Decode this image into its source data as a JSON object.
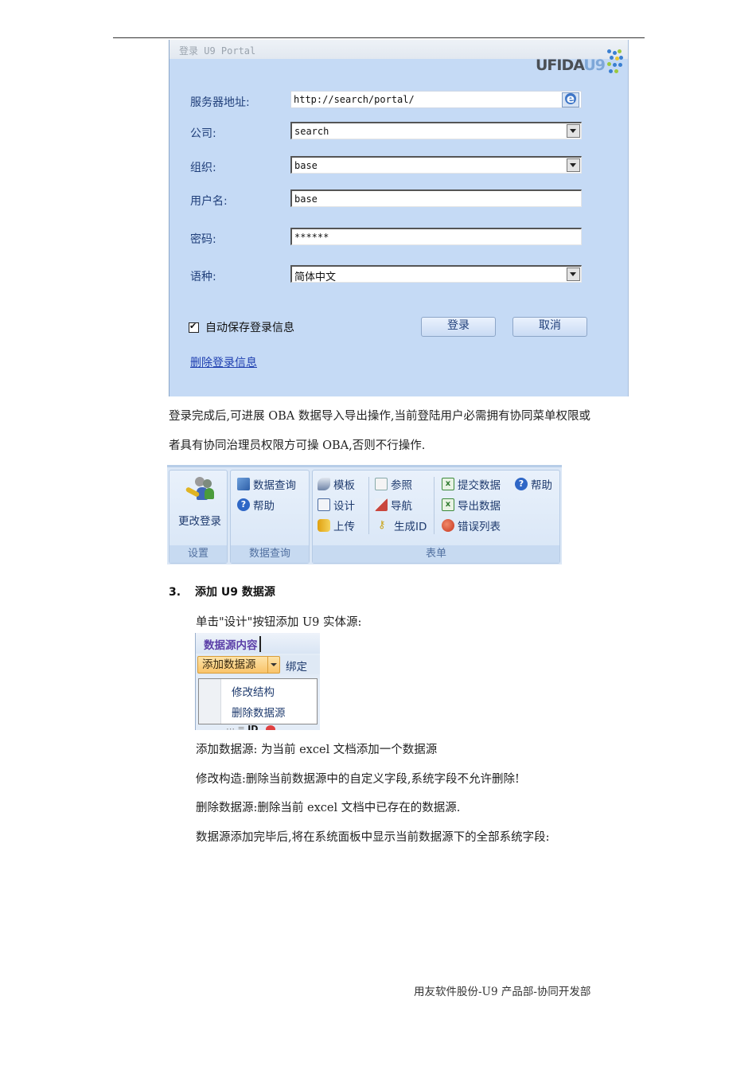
{
  "login_dialog": {
    "title": "登录 U9 Portal",
    "logo": {
      "text_main": "UFIDA",
      "text_accent": "U9"
    },
    "fields": [
      {
        "label": "服务器地址:",
        "value": "http://search/portal/",
        "type": "text",
        "icon": "ie-browse-icon"
      },
      {
        "label": "公司:",
        "value": "search",
        "type": "select"
      },
      {
        "label": "组织:",
        "value": "base",
        "type": "select"
      },
      {
        "label": "用户名:",
        "value": "base",
        "type": "text"
      },
      {
        "label": "密码:",
        "value": "******",
        "type": "password"
      },
      {
        "label": "语种:",
        "value": "简体中文",
        "type": "select"
      }
    ],
    "auto_save": {
      "label": "自动保存登录信息",
      "checked": true
    },
    "login_button": "登录",
    "cancel_button": "取消",
    "delete_link": "删除登录信息"
  },
  "paragraph1": {
    "line1": "登录完成后,可进展 OBA 数据导入导出操作,当前登陆用户必需拥有协同菜单权限或",
    "line2": "者具有协同治理员权限方可操  OBA,否则不行操作."
  },
  "ribbon": {
    "groups": [
      {
        "label": "设置",
        "items": [
          {
            "label": "更改登录",
            "icon": "change-login-icon"
          }
        ]
      },
      {
        "label": "数据查询",
        "items": [
          {
            "label": "数据查询",
            "icon": "data-query-icon"
          },
          {
            "label": "帮助",
            "icon": "help-icon"
          }
        ]
      },
      {
        "label": "表单",
        "columns": [
          [
            {
              "label": "模板",
              "icon": "template-icon"
            },
            {
              "label": "设计",
              "icon": "design-icon"
            },
            {
              "label": "上传",
              "icon": "upload-icon"
            }
          ],
          [
            {
              "label": "参照",
              "icon": "reference-icon"
            },
            {
              "label": "导航",
              "icon": "navigation-icon"
            },
            {
              "label": "生成ID",
              "icon": "key-icon"
            }
          ],
          [
            {
              "label": "提交数据",
              "icon": "excel-submit-icon"
            },
            {
              "label": "导出数据",
              "icon": "excel-export-icon"
            },
            {
              "label": "错误列表",
              "icon": "error-list-icon"
            }
          ],
          [
            {
              "label": "帮助",
              "icon": "help-icon"
            }
          ]
        ]
      }
    ]
  },
  "section3": {
    "number": "3.",
    "title": "添加  U9 数据源",
    "intro": "单击\"设计\"按钮添加  U9  实体源:"
  },
  "datasource_panel": {
    "header": "数据源内容",
    "add_button": "添加数据源",
    "bind_button": "绑定",
    "menu_items": [
      "修改结构",
      "删除数据源"
    ],
    "tree_fragment": "ID"
  },
  "descriptions": [
    "添加数据源:  为当前  excel 文档添加一个数据源",
    "修改构造:删除当前数据源中的自定义字段,系统字段不允许删除!",
    "删除数据源:删除当前  excel 文档中已存在的数据源.",
    "数据源添加完毕后,将在系统面板中显示当前数据源下的全部系统字段:"
  ],
  "footer": "用友软件股份-U9 产品部-协同开发部"
}
